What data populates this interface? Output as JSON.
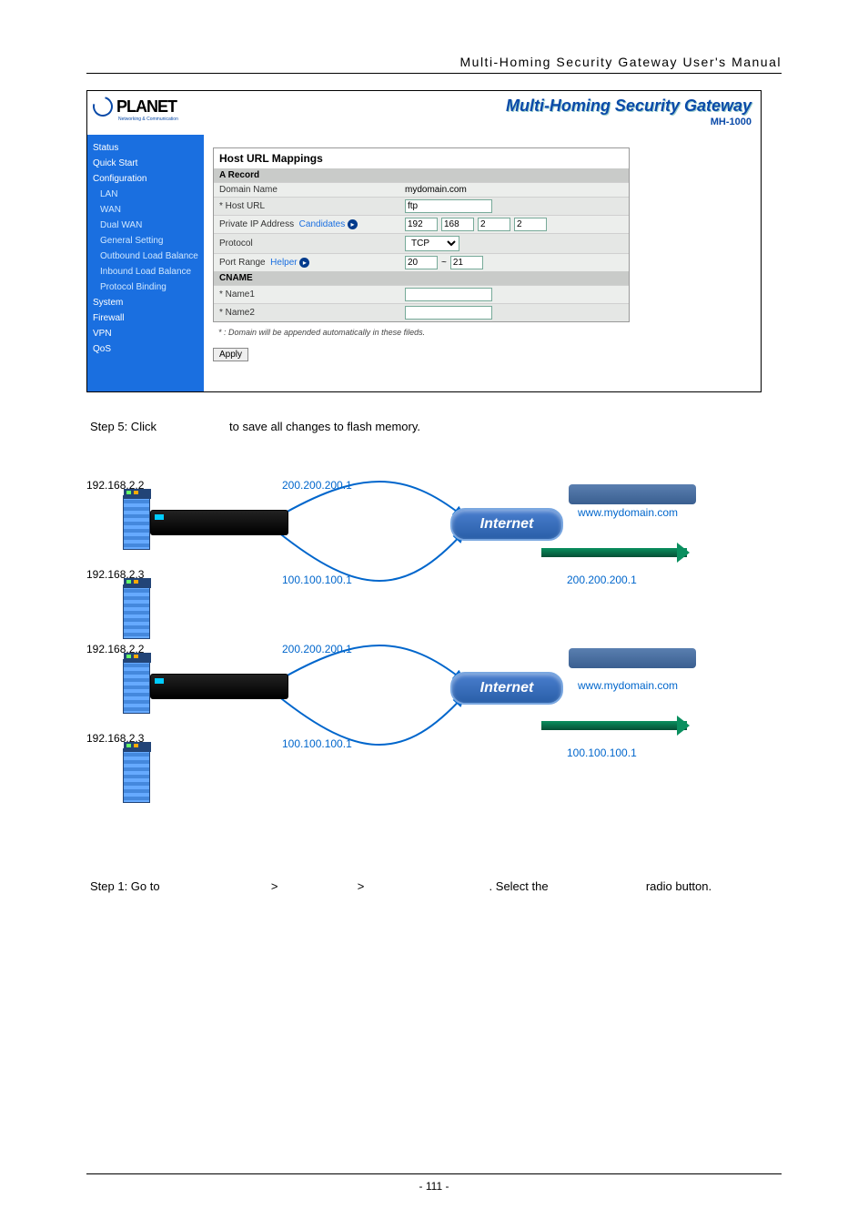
{
  "doc": {
    "header": "Multi-Homing Security Gateway User's Manual",
    "page_num": "- 111 -"
  },
  "ui": {
    "brand_title": "Multi-Homing Security Gateway",
    "brand_model": "MH-1000",
    "logo_text": "PLANET",
    "logo_sub": "Networking & Communication",
    "sidebar": {
      "items": [
        "Status",
        "Quick Start",
        "Configuration",
        "LAN",
        "WAN",
        "Dual WAN",
        "General Setting",
        "Outbound Load Balance",
        "Inbound Load Balance",
        "Protocol Binding",
        "System",
        "Firewall",
        "VPN",
        "QoS"
      ]
    },
    "panel": {
      "title_prefix": "Host ",
      "title_bold": "URL Mappings",
      "arec": "A Record",
      "rows": {
        "domain_label": "Domain Name",
        "domain_value": "mydomain.com",
        "host_label": "* Host URL",
        "host_value": "ftp",
        "priv_label": "Private IP Address",
        "cand_link": "Candidates",
        "ip1": "192",
        "ip2": "168",
        "ip3": "2",
        "ip4": "2",
        "proto_label": "Protocol",
        "proto_value": "TCP",
        "port_label": "Port Range",
        "helper_link": "Helper",
        "port1": "20",
        "port2": "21"
      },
      "cname": "CNAME",
      "name1_label": "* Name1",
      "name2_label": "* Name2",
      "note": "* : Domain will be appended automatically in these fileds.",
      "apply": "Apply"
    }
  },
  "step5": {
    "prefix": "Step 5: Click",
    "suffix": "to save all changes to flash memory."
  },
  "diagram": {
    "ip_server1": "192.168.2.2",
    "ip_server2": "192.168.2.3",
    "wan1": "200.200.200.1",
    "wan2": "100.100.100.1",
    "domain": "www.mydomain.com",
    "dns1": "200.200.200.1",
    "dns2": "100.100.100.1",
    "internet": "Internet"
  },
  "step1": {
    "t1": "Step 1: Go to",
    "t2": ">",
    "t3": ">",
    "t4": ". Select the",
    "t5": "radio button."
  }
}
